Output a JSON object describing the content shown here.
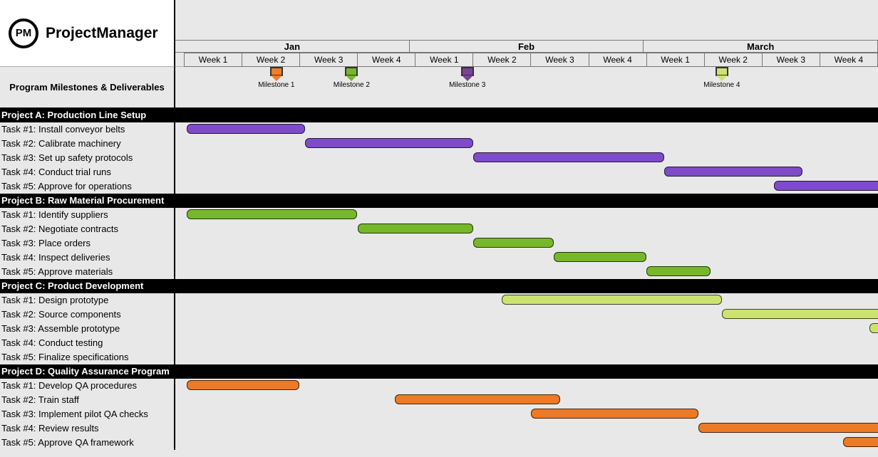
{
  "brand": {
    "initials": "PM",
    "name": "ProjectManager"
  },
  "timeline": {
    "months": [
      "Jan",
      "Feb",
      "March"
    ],
    "weeks": [
      "Week 1",
      "Week 2",
      "Week 3",
      "Week 4",
      "Week 1",
      "Week 2",
      "Week 3",
      "Week 4",
      "Week 1",
      "Week 2",
      "Week 3",
      "Week 4"
    ]
  },
  "milestones_section": {
    "label": "Program Milestones & Deliverables",
    "items": [
      {
        "label": "Milestone 1",
        "week_pos": 1.6,
        "color": "orange"
      },
      {
        "label": "Milestone 2",
        "week_pos": 2.9,
        "color": "green"
      },
      {
        "label": "Milestone 3",
        "week_pos": 4.9,
        "color": "purple"
      },
      {
        "label": "Milestone 4",
        "week_pos": 9.3,
        "color": "lime"
      }
    ]
  },
  "projects": [
    {
      "title": "Project A: Production Line Setup",
      "color": "purple",
      "tasks": [
        {
          "label": "Task #1: Install conveyor belts",
          "start": 0.05,
          "end": 2.1
        },
        {
          "label": "Task #2: Calibrate machinery",
          "start": 2.1,
          "end": 5.0
        },
        {
          "label": "Task #3: Set up safety protocols",
          "start": 5.0,
          "end": 8.3
        },
        {
          "label": "Task #4: Conduct trial runs",
          "start": 8.3,
          "end": 10.7
        },
        {
          "label": "Task #5: Approve for operations",
          "start": 10.2,
          "end": 12.1
        }
      ]
    },
    {
      "title": "Project B: Raw Material Procurement",
      "color": "green",
      "tasks": [
        {
          "label": "Task #1: Identify suppliers",
          "start": 0.05,
          "end": 3.0
        },
        {
          "label": "Task #2: Negotiate contracts",
          "start": 3.0,
          "end": 5.0
        },
        {
          "label": "Task #3: Place orders",
          "start": 5.0,
          "end": 6.4
        },
        {
          "label": "Task #4: Inspect deliveries",
          "start": 6.4,
          "end": 8.0
        },
        {
          "label": "Task #5: Approve materials",
          "start": 8.0,
          "end": 9.1
        }
      ]
    },
    {
      "title": "Project C: Product Development",
      "color": "lime",
      "tasks": [
        {
          "label": "Task #1: Design prototype",
          "start": 5.5,
          "end": 9.3
        },
        {
          "label": "Task #2: Source components",
          "start": 9.3,
          "end": 12.1
        },
        {
          "label": "Task #3: Assemble prototype",
          "start": 11.85,
          "end": 12.1
        },
        {
          "label": "Task #4: Conduct testing",
          "start": null,
          "end": null
        },
        {
          "label": "Task #5: Finalize specifications",
          "start": null,
          "end": null
        }
      ]
    },
    {
      "title": "Project D: Quality Assurance Program",
      "color": "orange",
      "tasks": [
        {
          "label": "Task #1: Develop QA procedures",
          "start": 0.05,
          "end": 2.0
        },
        {
          "label": "Task #2: Train staff",
          "start": 3.65,
          "end": 6.5
        },
        {
          "label": "Task #3: Implement pilot QA checks",
          "start": 6.0,
          "end": 8.9
        },
        {
          "label": "Task #4: Review results",
          "start": 8.9,
          "end": 12.1
        },
        {
          "label": "Task #5: Approve QA framework",
          "start": 11.4,
          "end": 12.1
        }
      ]
    }
  ],
  "chart_data": {
    "type": "gantt",
    "title": "Program Milestones & Deliverables",
    "x_axis": {
      "months": [
        "Jan",
        "Feb",
        "March"
      ],
      "weeks_per_month": 4,
      "total_weeks": 12
    },
    "milestones": [
      {
        "name": "Milestone 1",
        "week": 1.6,
        "color": "#F57C23"
      },
      {
        "name": "Milestone 2",
        "week": 2.9,
        "color": "#76B82A"
      },
      {
        "name": "Milestone 3",
        "week": 4.9,
        "color": "#7B4397"
      },
      {
        "name": "Milestone 4",
        "week": 9.3,
        "color": "#CDE36F"
      }
    ],
    "series": [
      {
        "name": "Project A: Production Line Setup",
        "color": "#7E4BC9",
        "bars": [
          {
            "task": "Install conveyor belts",
            "start_week": 0,
            "end_week": 2.1
          },
          {
            "task": "Calibrate machinery",
            "start_week": 2.1,
            "end_week": 5.0
          },
          {
            "task": "Set up safety protocols",
            "start_week": 5.0,
            "end_week": 8.3
          },
          {
            "task": "Conduct trial runs",
            "start_week": 8.3,
            "end_week": 10.7
          },
          {
            "task": "Approve for operations",
            "start_week": 10.2,
            "end_week": 12.0
          }
        ]
      },
      {
        "name": "Project B: Raw Material Procurement",
        "color": "#76B82A",
        "bars": [
          {
            "task": "Identify suppliers",
            "start_week": 0,
            "end_week": 3.0
          },
          {
            "task": "Negotiate contracts",
            "start_week": 3.0,
            "end_week": 5.0
          },
          {
            "task": "Place orders",
            "start_week": 5.0,
            "end_week": 6.4
          },
          {
            "task": "Inspect deliveries",
            "start_week": 6.4,
            "end_week": 8.0
          },
          {
            "task": "Approve materials",
            "start_week": 8.0,
            "end_week": 9.1
          }
        ]
      },
      {
        "name": "Project C: Product Development",
        "color": "#CDE36F",
        "bars": [
          {
            "task": "Design prototype",
            "start_week": 5.5,
            "end_week": 9.3
          },
          {
            "task": "Source components",
            "start_week": 9.3,
            "end_week": 12.0
          },
          {
            "task": "Assemble prototype",
            "start_week": 11.85,
            "end_week": 12.0
          },
          {
            "task": "Conduct testing",
            "start_week": null,
            "end_week": null
          },
          {
            "task": "Finalize specifications",
            "start_week": null,
            "end_week": null
          }
        ]
      },
      {
        "name": "Project D: Quality Assurance Program",
        "color": "#EC7A26",
        "bars": [
          {
            "task": "Develop QA procedures",
            "start_week": 0,
            "end_week": 2.0
          },
          {
            "task": "Train staff",
            "start_week": 3.65,
            "end_week": 6.5
          },
          {
            "task": "Implement pilot QA checks",
            "start_week": 6.0,
            "end_week": 8.9
          },
          {
            "task": "Review results",
            "start_week": 8.9,
            "end_week": 12.0
          },
          {
            "task": "Approve QA framework",
            "start_week": 11.4,
            "end_week": 12.0
          }
        ]
      }
    ]
  }
}
